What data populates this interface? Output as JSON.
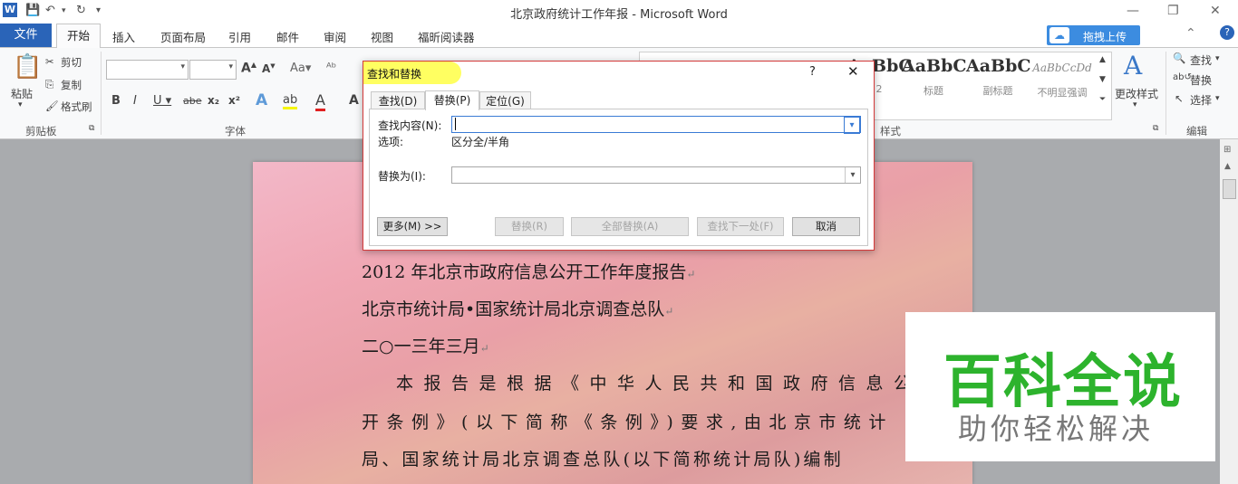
{
  "window": {
    "title": "北京政府统计工作年报 - Microsoft Word"
  },
  "tabs": {
    "file": "文件",
    "home": "开始",
    "items": [
      "插入",
      "页面布局",
      "引用",
      "邮件",
      "审阅",
      "视图",
      "福昕阅读器"
    ],
    "upload": "拖拽上传"
  },
  "ribbon": {
    "clipboard": {
      "paste": "粘贴",
      "cut": "剪切",
      "copy": "复制",
      "format_painter": "格式刷",
      "label": "剪贴板"
    },
    "font": {
      "label": "字体"
    },
    "styles": {
      "items": [
        {
          "preview": "AaBbC",
          "name": "2"
        },
        {
          "preview": "AaBbC",
          "name": "标题"
        },
        {
          "preview": "AaBbC",
          "name": "副标题"
        },
        {
          "preview": "AaBbCcDd",
          "name": "不明显强调"
        }
      ],
      "change": "更改样式",
      "label": "样式"
    },
    "editing": {
      "find": "查找",
      "replace": "替换",
      "select": "选择",
      "label": "编辑"
    }
  },
  "dialog": {
    "title": "查找和替换",
    "help": "?",
    "tabs": [
      "查找(D)",
      "替换(P)",
      "定位(G)"
    ],
    "find_label": "查找内容(N):",
    "find_value": "",
    "options_label": "选项:",
    "options_value": "区分全/半角",
    "replace_label": "替换为(I):",
    "replace_value": "",
    "buttons": {
      "more": "更多(M) >>",
      "replace": "替换(R)",
      "replace_all": "全部替换(A)",
      "find_next": "查找下一处(F)",
      "cancel": "取消"
    }
  },
  "document": {
    "lines": [
      "2012 年北京市政府信息公开工作年度报告",
      "北京市统计局•国家统计局北京调查总队",
      "二○一三年三月",
      "本报告是根据《中华人民共和国政府信息公",
      "开条例》(以下简称《条例》)要求,由北京市统计",
      "局、国家统计局北京调查总队(以下简称统计局队)编制"
    ]
  },
  "watermark": {
    "main": "百科全说",
    "sub": "助你轻松解决"
  }
}
